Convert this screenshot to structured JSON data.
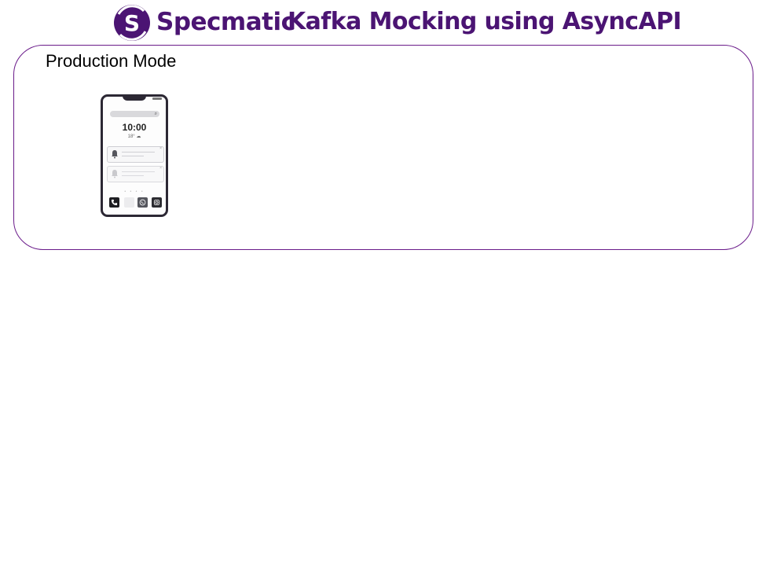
{
  "header": {
    "brand_name": "Specmatic",
    "title": "Kafka Mocking using AsyncAPI",
    "brand_color": "#4b1473"
  },
  "panel": {
    "label": "Production Mode",
    "border_color": "#6a1b8a"
  },
  "phone": {
    "time": "10:00",
    "weather": "18° ☁",
    "notifications": [
      {
        "icon": "bell-icon"
      },
      {
        "icon": "bell-icon"
      }
    ],
    "page_dots": "• • • •",
    "dock_icons": [
      "phone-icon",
      "blank-app-icon",
      "whatsapp-icon",
      "instagram-icon"
    ]
  }
}
